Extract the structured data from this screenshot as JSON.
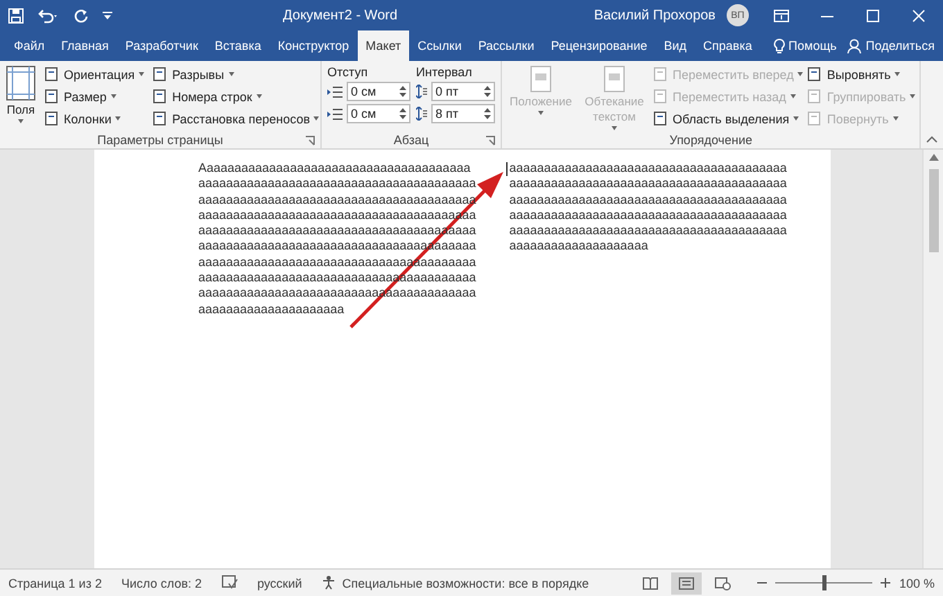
{
  "window": {
    "title": "Документ2  -  Word",
    "user": "Василий Прохоров",
    "avatar": "ВП"
  },
  "tabs": [
    {
      "label": "Файл",
      "selected": false
    },
    {
      "label": "Главная",
      "selected": false
    },
    {
      "label": "Разработчик",
      "selected": false
    },
    {
      "label": "Вставка",
      "selected": false
    },
    {
      "label": "Конструктор",
      "selected": false
    },
    {
      "label": "Макет",
      "selected": true
    },
    {
      "label": "Ссылки",
      "selected": false
    },
    {
      "label": "Рассылки",
      "selected": false
    },
    {
      "label": "Рецензирование",
      "selected": false
    },
    {
      "label": "Вид",
      "selected": false
    },
    {
      "label": "Справка",
      "selected": false
    }
  ],
  "tell_me": "Помощь",
  "share": "Поделиться",
  "ribbon": {
    "page_setup": {
      "label": "Параметры страницы",
      "big_button": "Поля",
      "column_1": [
        {
          "label": "Ориентация"
        },
        {
          "label": "Размер"
        },
        {
          "label": "Колонки"
        }
      ],
      "column_2": [
        {
          "label": "Разрывы"
        },
        {
          "label": "Номера строк"
        },
        {
          "label": "Расстановка переносов"
        }
      ]
    },
    "paragraph": {
      "label": "Абзац",
      "indent_label": "Отступ",
      "spacing_label": "Интервал",
      "indent": [
        "0 см",
        "0 см"
      ],
      "spacing": [
        "0 пт",
        "8 пт"
      ]
    },
    "arrange": {
      "label": "Упорядочение",
      "big_buttons": [
        {
          "label": "Положение",
          "disabled": true
        },
        {
          "label": "Обтекание текстом",
          "disabled": true
        }
      ],
      "column_1": [
        {
          "label": "Переместить вперед",
          "disabled": true
        },
        {
          "label": "Переместить назад",
          "disabled": true
        },
        {
          "label": "Область выделения",
          "disabled": false
        }
      ],
      "column_2": [
        {
          "label": "Выровнять",
          "disabled": false
        },
        {
          "label": "Группировать",
          "disabled": true
        },
        {
          "label": "Повернуть",
          "disabled": true
        }
      ]
    }
  },
  "document": {
    "column_1": [
      "Aaaaaaaaaaaaaaaaaaaaaaaaaaaaaaaaaaaaaaa",
      "aaaaaaaaaaaaaaaaaaaaaaaaaaaaaaaaaaaaaaaa",
      "aaaaaaaaaaaaaaaaaaaaaaaaaaaaaaaaaaaaaaaa",
      "aaaaaaaaaaaaaaaaaaaaaaaaaaaaaaaaaaaaaaaa",
      "aaaaaaaaaaaaaaaaaaaaaaaaaaaaaaaaaaaaaaaa",
      "aaaaaaaaaaaaaaaaaaaaaaaaaaaaaaaaaaaaaaaa",
      "aaaaaaaaaaaaaaaaaaaaaaaaaaaaaaaaaaaaaaaa",
      "aaaaaaaaaaaaaaaaaaaaaaaaaaaaaaaaaaaaaaaa",
      "aaaaaaaaaaaaaaaaaaaaaaaaaaaaaaaaaaaaaaaa",
      "aaaaaaaaaaaaaaaaaaaaa"
    ],
    "column_2": [
      "aaaaaaaaaaaaaaaaaaaaaaaaaaaaaaaaaaaaaaaa",
      "aaaaaaaaaaaaaaaaaaaaaaaaaaaaaaaaaaaaaaaa",
      "aaaaaaaaaaaaaaaaaaaaaaaaaaaaaaaaaaaaaaaa",
      "aaaaaaaaaaaaaaaaaaaaaaaaaaaaaaaaaaaaaaaa",
      "aaaaaaaaaaaaaaaaaaaaaaaaaaaaaaaaaaaaaaaa",
      "aaaaaaaaaaaaaaaaaaaa"
    ]
  },
  "status_bar": {
    "page": "Страница 1 из 2",
    "words": "Число слов: 2",
    "language": "русский",
    "accessibility": "Специальные возможности: все в порядке",
    "views": [
      {
        "kind": "read",
        "selected": false
      },
      {
        "kind": "print",
        "selected": true
      },
      {
        "kind": "web",
        "selected": false
      }
    ],
    "zoom": {
      "level": 0.5,
      "reading": "100 %"
    }
  }
}
